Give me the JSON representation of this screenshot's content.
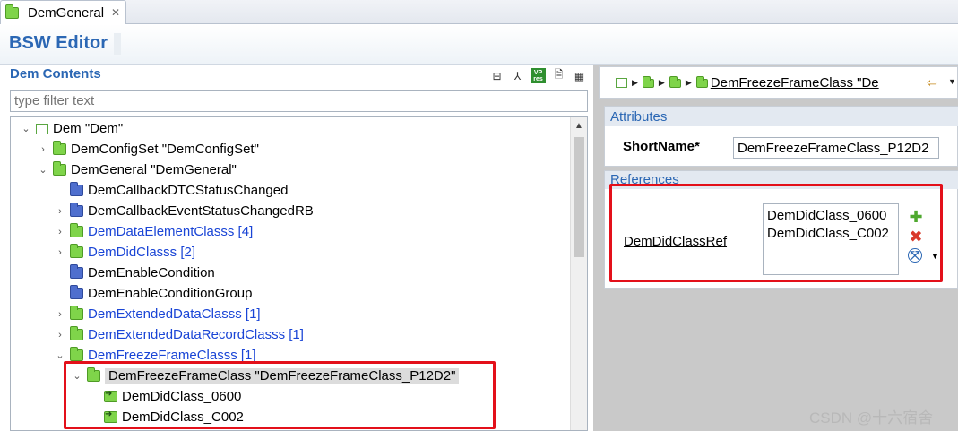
{
  "tab": {
    "label": "DemGeneral",
    "close": "✕"
  },
  "editor": {
    "title": "BSW Editor"
  },
  "left": {
    "title": "Dem Contents",
    "filter_placeholder": "type filter text",
    "toolbar_icons": [
      "collapse-all-icon",
      "fork-icon",
      "vp-res-icon",
      "document-icon",
      "grid-icon"
    ],
    "vp_text": "VP\nres"
  },
  "tree": [
    {
      "label": "Dem \"Dem\"",
      "icon": "module-icon",
      "chevron": "⌄",
      "blue": false
    },
    {
      "label": "DemConfigSet \"DemConfigSet\"",
      "icon": "folder-icon",
      "chevron": "›",
      "blue": false
    },
    {
      "label": "DemGeneral \"DemGeneral\"",
      "icon": "folder-icon",
      "chevron": "⌄",
      "blue": false
    },
    {
      "label": "DemCallbackDTCStatusChanged",
      "icon": "blue-folder-icon",
      "chevron": "",
      "blue": false
    },
    {
      "label": "DemCallbackEventStatusChangedRB",
      "icon": "blue-folder-icon",
      "chevron": "›",
      "blue": false
    },
    {
      "label": "DemDataElementClasss [4]",
      "icon": "folder-icon",
      "chevron": "›",
      "blue": true
    },
    {
      "label": "DemDidClasss [2]",
      "icon": "folder-icon",
      "chevron": "›",
      "blue": true
    },
    {
      "label": "DemEnableCondition",
      "icon": "blue-folder-icon",
      "chevron": "",
      "blue": false
    },
    {
      "label": "DemEnableConditionGroup",
      "icon": "blue-folder-icon",
      "chevron": "",
      "blue": false
    },
    {
      "label": "DemExtendedDataClasss [1]",
      "icon": "folder-icon",
      "chevron": "›",
      "blue": true
    },
    {
      "label": "DemExtendedDataRecordClasss [1]",
      "icon": "folder-icon",
      "chevron": "›",
      "blue": true
    },
    {
      "label": "DemFreezeFrameClasss [1]",
      "icon": "folder-icon",
      "chevron": "⌄",
      "blue": true
    },
    {
      "label": "DemFreezeFrameClass \"DemFreezeFrameClass_P12D2\"",
      "icon": "folder-icon",
      "chevron": "⌄",
      "blue": false,
      "selected": true
    },
    {
      "label": "DemDidClass_0600",
      "icon": "reference-icon",
      "chevron": "",
      "blue": false
    },
    {
      "label": "DemDidClass_C002",
      "icon": "reference-icon",
      "chevron": "",
      "blue": false
    }
  ],
  "breadcrumb": {
    "link": "DemFreezeFrameClass \"De",
    "separator": "▶",
    "nav_back": "⇦",
    "nav_dropdown": "▼"
  },
  "attributes": {
    "title": "Attributes",
    "short_name_label": "ShortName*",
    "short_name_value": "DemFreezeFrameClass_P12D2"
  },
  "references": {
    "title": "References",
    "label": "DemDidClassRef",
    "items": [
      "DemDidClass_0600",
      "DemDidClass_C002"
    ],
    "add": "✚",
    "remove": "✖",
    "browse": "⤧",
    "dropdown": "▼"
  },
  "watermark": "CSDN @十六宿舍",
  "colors": {
    "accent": "#2b67b4",
    "link_blue": "#1a45d6",
    "highlight": "#e3101a",
    "folder_green": "#7fd44a"
  }
}
